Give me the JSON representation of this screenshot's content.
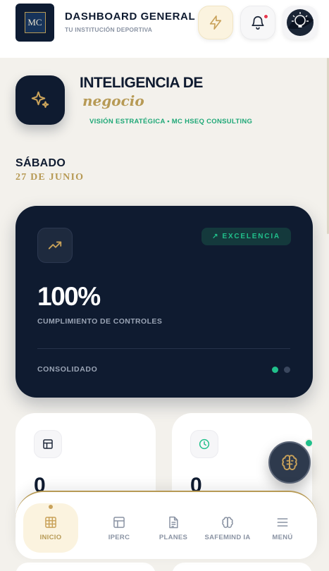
{
  "header": {
    "logo_text": "MC",
    "title": "DASHBOARD GENERAL",
    "subtitle": "TU INSTITUCIÓN DEPORTIVA"
  },
  "hero": {
    "title": "INTELIGENCIA DE",
    "accent": "negocio",
    "subtitle": "VISIÓN ESTRATÉGICA • MC HSEQ CONSULTING"
  },
  "date": {
    "weekday": "SÁBADO",
    "date": "27 DE JUNIO"
  },
  "kpi_card": {
    "badge_arrow": "↗",
    "badge": "EXCELENCIA",
    "value": "100%",
    "label": "CUMPLIMIENTO DE CONTROLES",
    "footer": "CONSOLIDADO",
    "active_page_index": 0,
    "page_count": 2
  },
  "mini_cards": [
    {
      "icon": "table-icon",
      "value": "0"
    },
    {
      "icon": "clock-icon",
      "value": "0"
    }
  ],
  "nav": {
    "items": [
      {
        "label": "INICIO",
        "icon": "grid-icon",
        "active": true
      },
      {
        "label": "IPERC",
        "icon": "table-icon",
        "active": false
      },
      {
        "label": "PLANES",
        "icon": "document-icon",
        "active": false
      },
      {
        "label": "SAFEMIND IA",
        "icon": "brain-icon",
        "active": false
      },
      {
        "label": "MENÚ",
        "icon": "menu-icon",
        "active": false
      }
    ]
  },
  "colors": {
    "navy": "#0f1b30",
    "gold": "#b79a55",
    "green": "#21c08b",
    "background": "#f3f1ec"
  }
}
